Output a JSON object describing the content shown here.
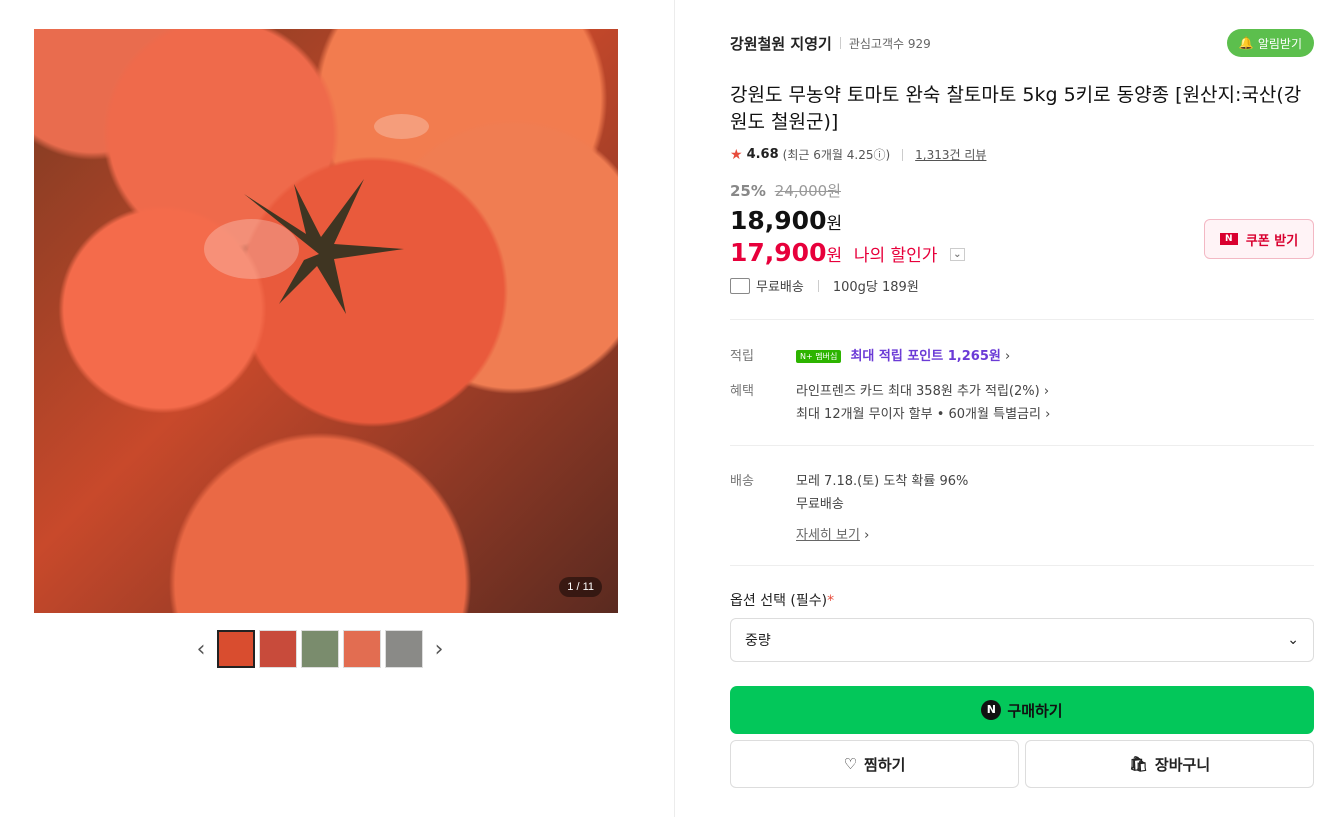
{
  "gallery": {
    "counter": "1 / 11",
    "prev": "‹",
    "next": "›",
    "thumbs": [
      {
        "color": "#d94d2f"
      },
      {
        "color": "#c84b3b"
      },
      {
        "color": "#7a8c6d"
      },
      {
        "color": "#e26d51"
      },
      {
        "color": "#8a8a87"
      }
    ]
  },
  "store": {
    "name": "강원철원 지영기",
    "interest_label": "관심고객수 929",
    "notify_button": "알림받기"
  },
  "product": {
    "title": "강원도 무농약 토마토 완숙 찰토마토 5kg 5키로 동양종 [원산지:국산(강원도 철원군)]",
    "rating": "4.68",
    "recent_rating": "(최근 6개월 4.25ⓘ)",
    "reviews": "1,313건 리뷰"
  },
  "price": {
    "discount": "25%",
    "original": "24,000원",
    "sale": "18,900",
    "sale_unit": "원",
    "my_price": "17,900",
    "my_price_unit": "원",
    "my_price_label": "나의 할인가",
    "coupon_button": "쿠폰 받기",
    "shipping": "무료배송",
    "unit_price": "100g당 189원"
  },
  "benefits": {
    "points_label": "적립",
    "points_badge": "N+ 멤버십",
    "points_text": "최대 적립 포인트 1,265원",
    "benefit_label": "혜택",
    "benefit_1": "라인프렌즈 카드 최대 358원 추가 적립(2%)",
    "benefit_2": "최대 12개월 무이자 할부 • 60개월 특별금리"
  },
  "delivery": {
    "label": "배송",
    "arrival": "모레 7.18.(토) 도착 확률 96%",
    "free": "무료배송",
    "details": "자세히 보기"
  },
  "option": {
    "label": "옵션 선택 (필수)",
    "required_mark": "*",
    "selected": "중량"
  },
  "actions": {
    "buy": "구매하기",
    "wish": "찜하기",
    "cart": "장바구니"
  }
}
